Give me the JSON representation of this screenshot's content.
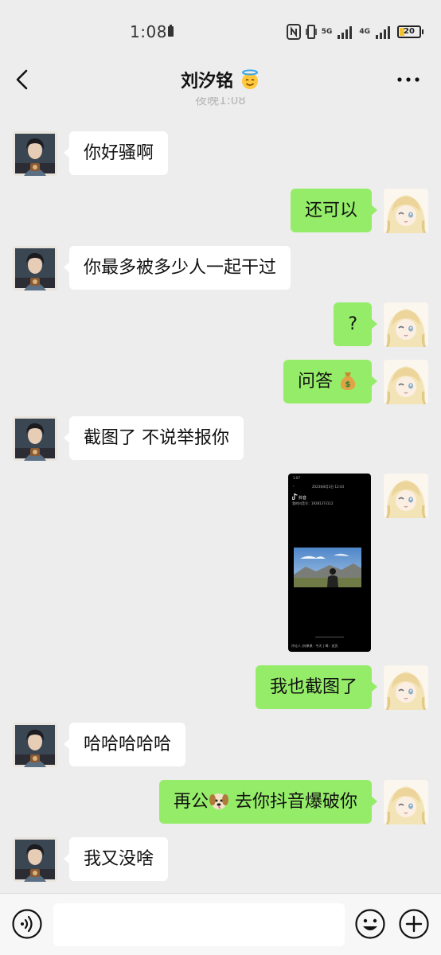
{
  "status_bar": {
    "time": "1:08",
    "network_5g": "5G",
    "network_4g": "4G",
    "battery": "20"
  },
  "header": {
    "title": "刘汐铭",
    "cut_timestamp": "夜晚1:08"
  },
  "messages": [
    {
      "sender": "other",
      "text": "你好骚啊"
    },
    {
      "sender": "self",
      "text": "还可以"
    },
    {
      "sender": "other",
      "text": "你最多被多少人一起干过"
    },
    {
      "sender": "self",
      "text": "?"
    },
    {
      "sender": "self",
      "text": "问答",
      "emoji": "money-bag"
    },
    {
      "sender": "other",
      "text": "截图了 不说举报你"
    },
    {
      "sender": "self",
      "type": "image",
      "image": {
        "status_time": "1:07",
        "date_line": "2023年8月3日 12:43",
        "app_name": "抖音",
        "account_line": "我的抖音号：192813?3112",
        "footer": "评论人 |何果果 · 今天 | 喝：进页"
      }
    },
    {
      "sender": "self",
      "text": "我也截图了"
    },
    {
      "sender": "other",
      "text": "哈哈哈哈哈"
    },
    {
      "sender": "self",
      "text_before": "再公",
      "emoji": "dog-face",
      "text_after": " 去你抖音爆破你"
    },
    {
      "sender": "other",
      "text": "我又没啥"
    }
  ],
  "input_bar": {
    "placeholder": ""
  },
  "colors": {
    "background": "#ededed",
    "bubble_in": "#ffffff",
    "bubble_out": "#95ec69",
    "input_bar": "#f7f7f7"
  }
}
